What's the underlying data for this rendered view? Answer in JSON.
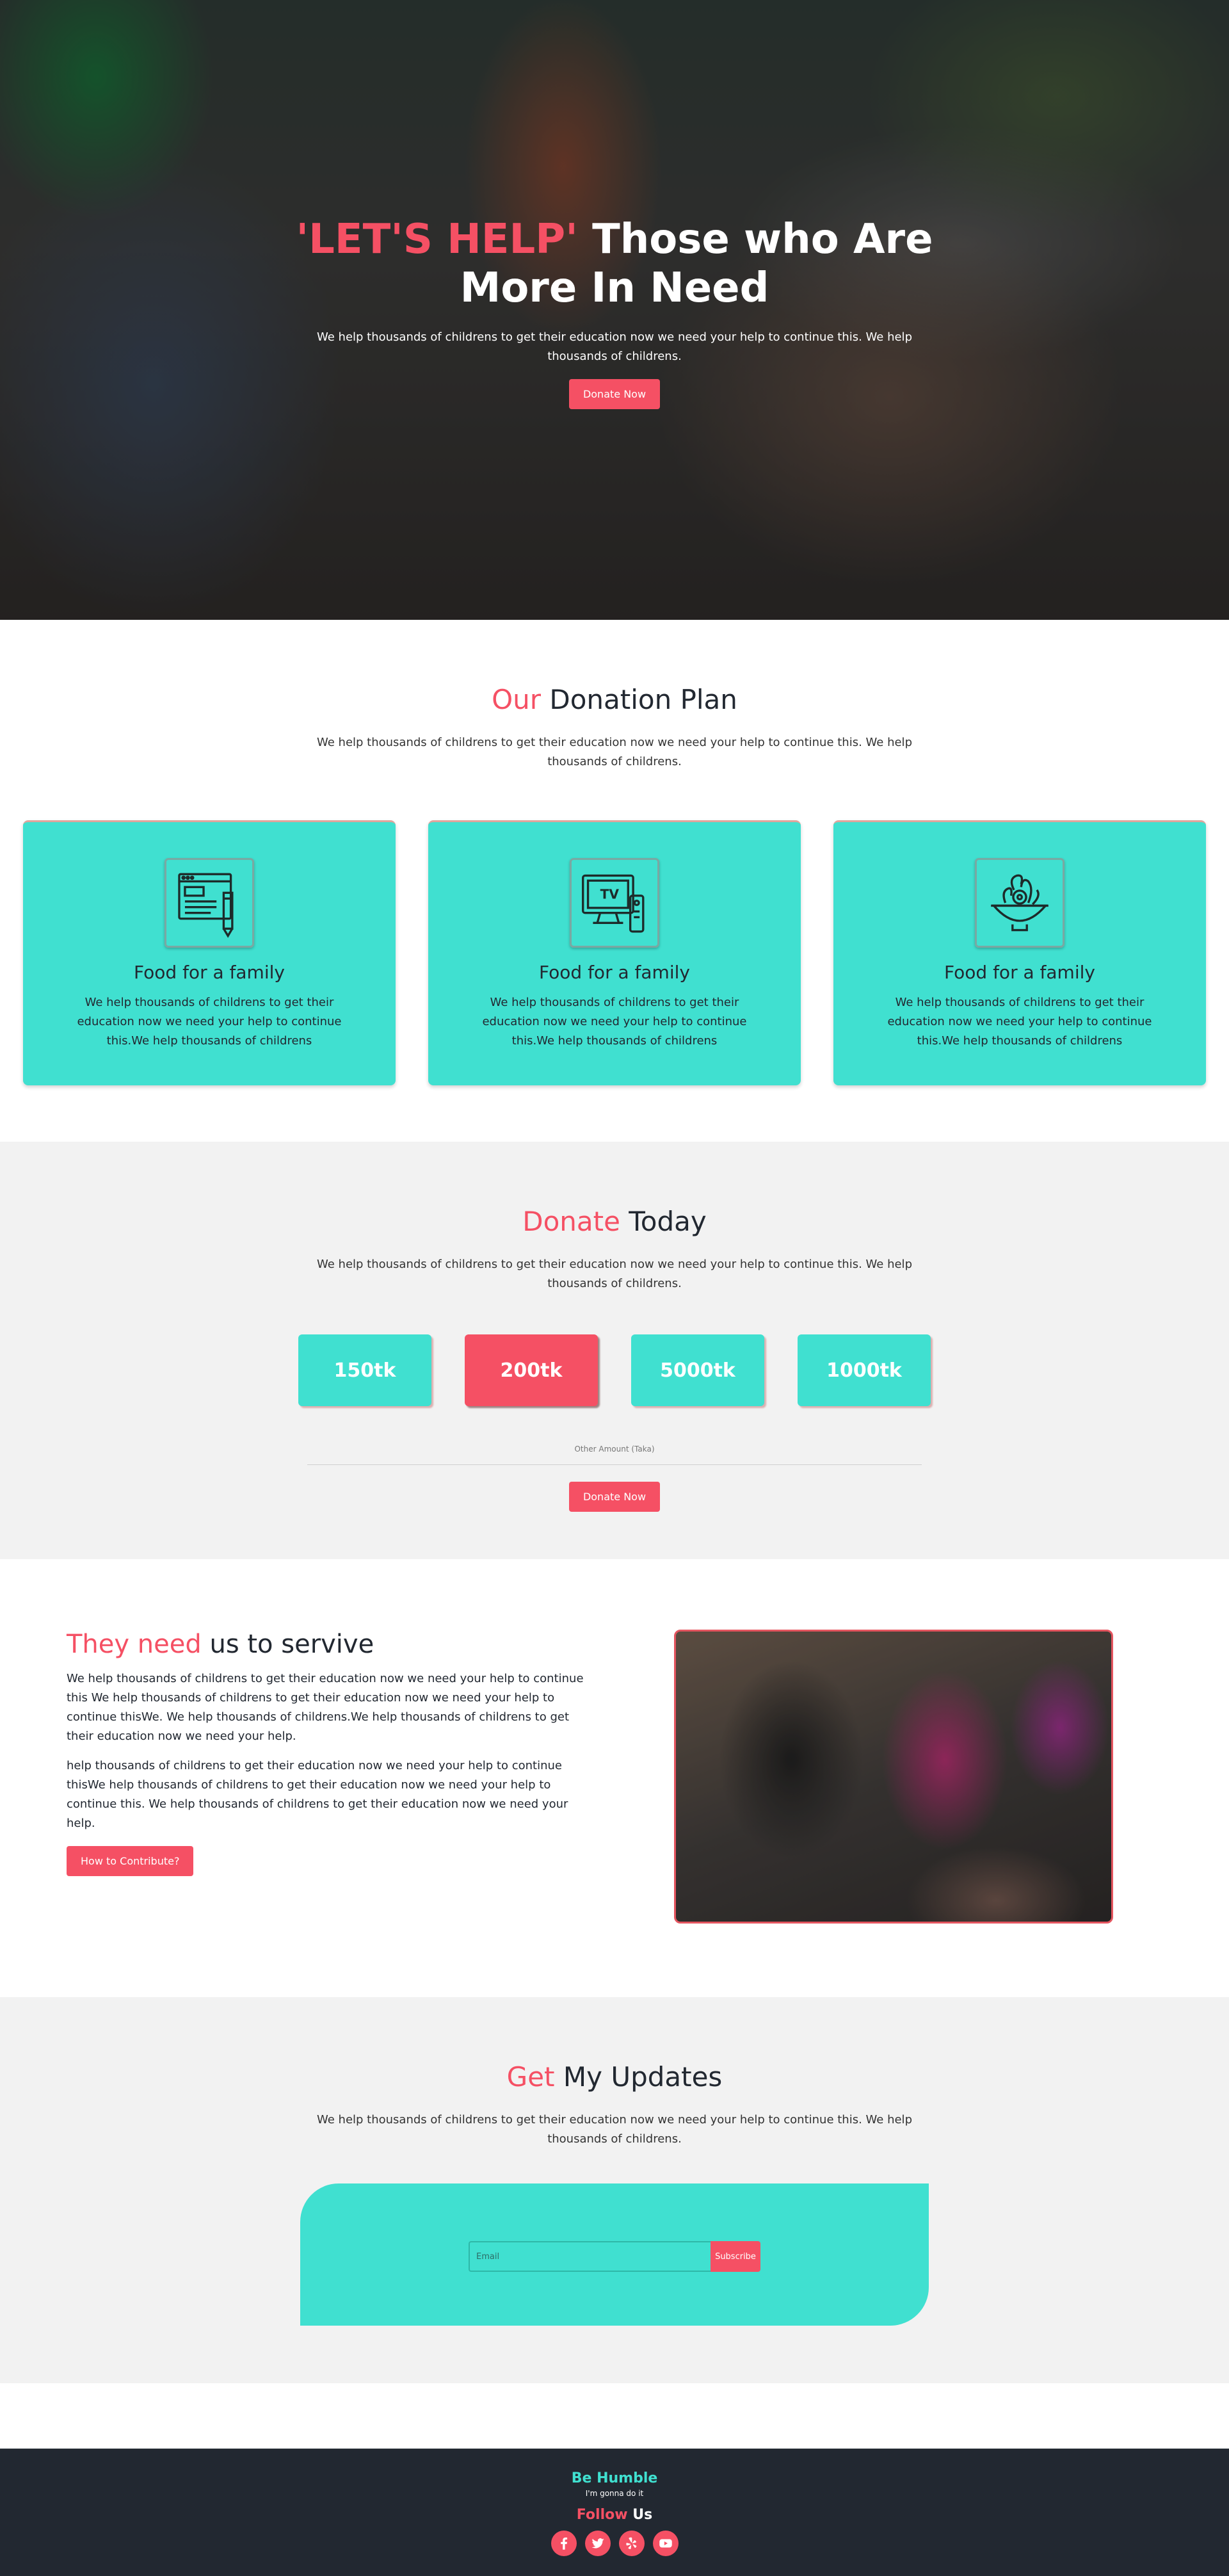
{
  "hero": {
    "title_accent": "'LET'S HELP'",
    "title_rest": " Those who Are",
    "title_line2": "More In Need",
    "text": "We help thousands of childrens to get their education now we need your help to continue this. We help thousands of childrens.",
    "button_label": "Donate Now"
  },
  "plan": {
    "title_accent": "Our",
    "title_rest": " Donation Plan",
    "text": "We help thousands of childrens to get their education now we need your help to continue this. We help thousands of childrens.",
    "cards": [
      {
        "icon": "web-document-icon",
        "title": "Food for a family",
        "text": "We help thousands of childrens to get their education now we need your help to continue this.We help thousands of childrens"
      },
      {
        "icon": "tv-remote-icon",
        "title": "Food for a family",
        "text": "We help thousands of childrens to get their education now we need your help to continue this.We help thousands of childrens"
      },
      {
        "icon": "food-bowl-icon",
        "title": "Food for a family",
        "text": "We help thousands of childrens to get their education now we need your help to continue this.We help thousands of childrens"
      }
    ]
  },
  "donate": {
    "title_accent": "Donate",
    "title_rest": " Today",
    "text": "We help thousands of childrens to get their education now we need your help to continue this. We help thousands of childrens.",
    "amounts": [
      "150tk",
      "200tk",
      "5000tk",
      "1000tk"
    ],
    "selected_amount": "200tk",
    "other_label": "Other Amount (Taka)",
    "other_value": "",
    "button_label": "Donate Now"
  },
  "survive": {
    "title_accent": "They need",
    "title_rest": " us to servive",
    "p1": "We help thousands of childrens to get their education now we need your help to continue this We help thousands of childrens to get their education now we need your help to continue thisWe. We help thousands of childrens.We help thousands of childrens to get their education now we need your help.",
    "p2": "help thousands of childrens to get their education now we need your help to continue thisWe help thousands of childrens to get their education now we need your help to continue this. We help thousands of childrens to get their education now we need your help.",
    "button_label": "How to Contribute?"
  },
  "updates": {
    "title_accent": "Get",
    "title_rest": " My Updates",
    "text": "We help thousands of childrens to get their education now we need your help to continue this. We help thousands of childrens.",
    "email_placeholder": "Email",
    "email_value": "",
    "button_label": "Subscribe"
  },
  "footer": {
    "brand": "Be Humble",
    "tagline": "I'm gonna do it",
    "follow_accent": "Follow",
    "follow_rest": " Us",
    "socials": [
      "facebook-icon",
      "twitter-icon",
      "yelp-icon",
      "youtube-icon"
    ]
  },
  "colors": {
    "accent": "#f55064",
    "teal": "#40e0d0",
    "dark": "#222831",
    "light_bg": "#f2f2f2"
  }
}
